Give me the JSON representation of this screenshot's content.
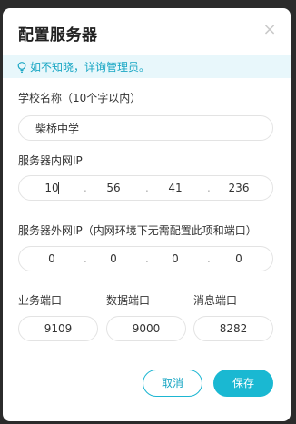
{
  "dialog": {
    "title": "配置服务器",
    "close_glyph": "×",
    "tip": "如不知晓，详询管理员。"
  },
  "school": {
    "label": "学校名称（10个字以内）",
    "value": "柴桥中学"
  },
  "intranet": {
    "label": "服务器内网IP",
    "octets": [
      "10",
      "56",
      "41",
      "236"
    ],
    "dot": "."
  },
  "extranet": {
    "label": "服务器外网IP（内网环境下无需配置此项和端口）",
    "octets": [
      "0",
      "0",
      "0",
      "0"
    ],
    "dot": "."
  },
  "ports": {
    "business_label": "业务端口",
    "business_value": "9109",
    "data_label": "数据端口",
    "data_value": "9000",
    "message_label": "消息端口",
    "message_value": "8282"
  },
  "buttons": {
    "cancel": "取消",
    "save": "保存"
  },
  "colors": {
    "accent": "#1ab8d2",
    "tip_bg": "#e8f7fb",
    "tip_text": "#1aa7c4"
  }
}
